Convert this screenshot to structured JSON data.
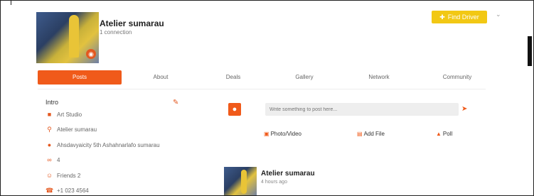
{
  "profile": {
    "name": "Atelier sumarau",
    "subtitle": "1 connection",
    "find_button": "Find Driver"
  },
  "tabs": [
    {
      "label": "Posts",
      "active": true
    },
    {
      "label": "About",
      "active": false
    },
    {
      "label": "Deals",
      "active": false
    },
    {
      "label": "Gallery",
      "active": false
    },
    {
      "label": "Network",
      "active": false
    },
    {
      "label": "Community",
      "active": false
    }
  ],
  "about": {
    "title": "Intro",
    "rows": [
      {
        "icon": "video-icon",
        "text": "Art Studio"
      },
      {
        "icon": "search-icon",
        "text": "Atelier sumarau"
      },
      {
        "icon": "location-icon",
        "text": "Ahsdavyaicity 5th Ashahnarlafo sumarau"
      },
      {
        "icon": "link-icon",
        "text": "4"
      },
      {
        "icon": "people-icon",
        "text": "Friends 2"
      },
      {
        "icon": "phone-icon",
        "text": "+1 023 4564"
      }
    ]
  },
  "composer": {
    "placeholder": "Write something to post here...",
    "actions": [
      "Photo/Video",
      "Add File",
      "Poll"
    ]
  },
  "post": {
    "author": "Atelier sumarau",
    "meta": "4 hours ago"
  },
  "colors": {
    "accent": "#f05a1a",
    "button": "#f2c814"
  }
}
